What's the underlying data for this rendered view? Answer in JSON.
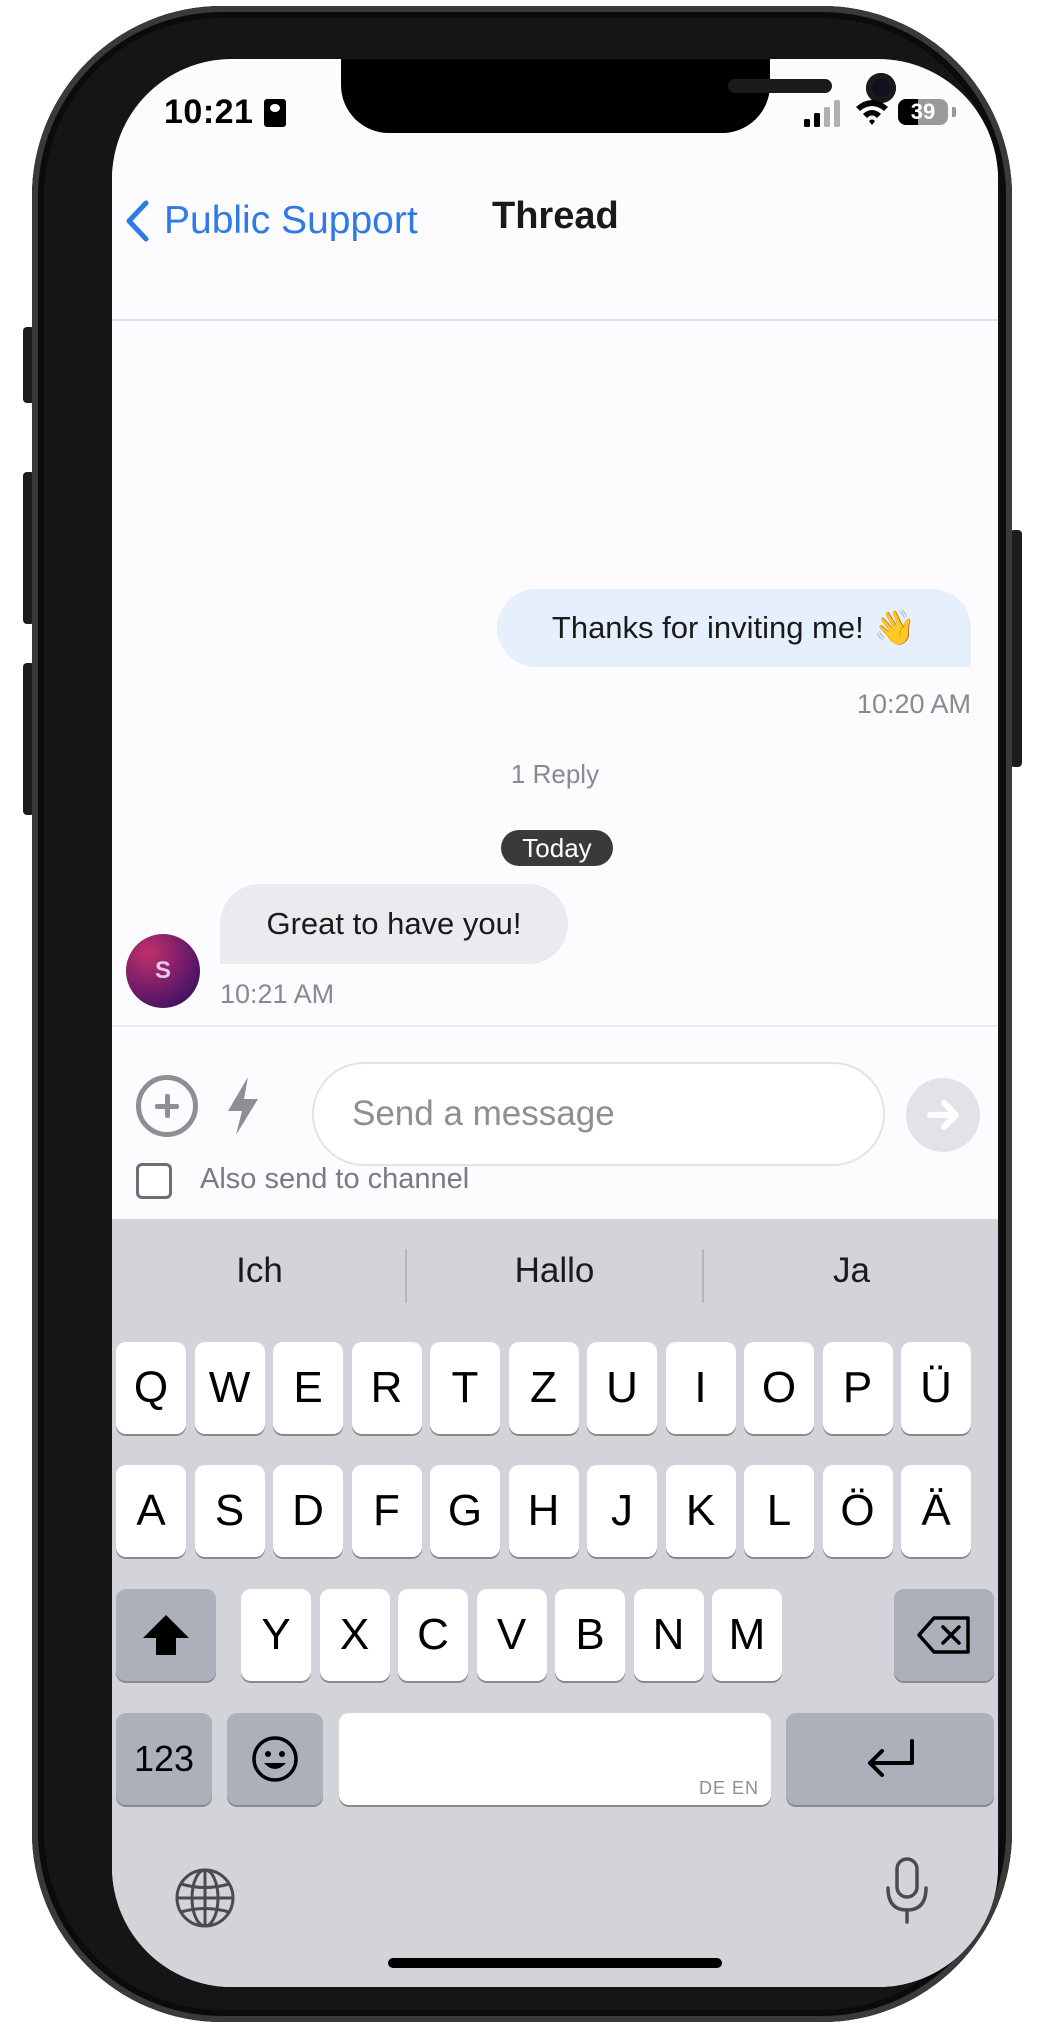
{
  "status_bar": {
    "time": "10:21",
    "battery": "39"
  },
  "header": {
    "back_label": "Public Support",
    "title": "Thread"
  },
  "messages": {
    "outgoing": {
      "text": "Thanks for inviting me!",
      "emoji": "👋",
      "time": "10:20 AM"
    },
    "reply_count": "1 Reply",
    "date_divider": "Today",
    "incoming": {
      "text": "Great to have you!",
      "avatar_initial": "S",
      "time": "10:21 AM"
    }
  },
  "composer": {
    "placeholder": "Send a message",
    "also_send_label": "Also send to channel",
    "also_send_checked": false
  },
  "keyboard": {
    "suggestions": [
      "Ich",
      "Hallo",
      "Ja"
    ],
    "row1": [
      "Q",
      "W",
      "E",
      "R",
      "T",
      "Z",
      "U",
      "I",
      "O",
      "P",
      "Ü"
    ],
    "row2": [
      "A",
      "S",
      "D",
      "F",
      "G",
      "H",
      "J",
      "K",
      "L",
      "Ö",
      "Ä"
    ],
    "row3": [
      "Y",
      "X",
      "C",
      "V",
      "B",
      "N",
      "M"
    ],
    "numbers_key": "123",
    "space_languages": "DE EN",
    "emoji_key": "😀"
  },
  "colors": {
    "accent": "#2f7be6",
    "outgoing_bubble": "#e6f0fd",
    "incoming_bubble": "#ebeaee",
    "keyboard_bg": "#d3d4da"
  }
}
